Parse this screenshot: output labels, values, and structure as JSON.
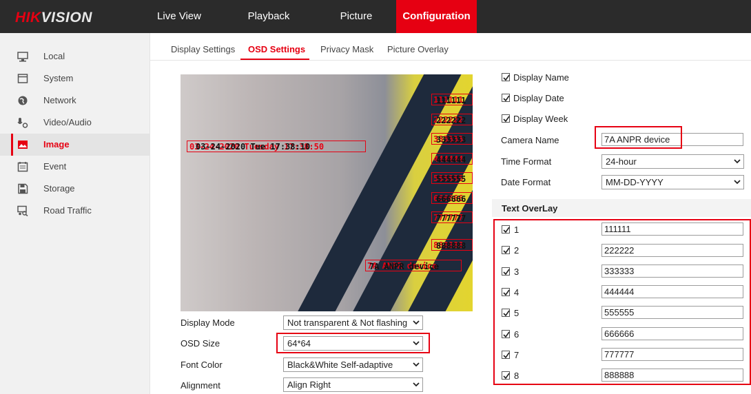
{
  "brand": {
    "part1": "HIK",
    "part2": "VISION"
  },
  "top_nav": [
    {
      "label": "Live View"
    },
    {
      "label": "Playback"
    },
    {
      "label": "Picture"
    },
    {
      "label": "Configuration",
      "active": true
    }
  ],
  "sidebar": [
    {
      "label": "Local"
    },
    {
      "label": "System"
    },
    {
      "label": "Network"
    },
    {
      "label": "Video/Audio"
    },
    {
      "label": "Image",
      "active": true
    },
    {
      "label": "Event"
    },
    {
      "label": "Storage"
    },
    {
      "label": "Road Traffic"
    }
  ],
  "sub_tabs": [
    {
      "label": "Display Settings"
    },
    {
      "label": "OSD Settings",
      "active": true
    },
    {
      "label": "Privacy Mask"
    },
    {
      "label": "Picture Overlay"
    }
  ],
  "osd_preview": {
    "datetime_red": "03-24-2020 Tuesday 17:38:50",
    "datetime_black": "03-24-2020 Tue 17:38:10",
    "camera_name_red": "7A ANPR device",
    "camera_name_black": "7A ANPR device",
    "overlays": [
      "111111",
      "222222",
      "333333",
      "444444",
      "555555",
      "666666",
      "777777",
      "888888"
    ]
  },
  "left_settings": {
    "display_mode": {
      "label": "Display Mode",
      "value": "Not transparent & Not flashing"
    },
    "osd_size": {
      "label": "OSD Size",
      "value": "64*64"
    },
    "font_color": {
      "label": "Font Color",
      "value": "Black&White Self-adaptive"
    },
    "alignment": {
      "label": "Alignment",
      "value": "Align Right"
    }
  },
  "right_settings": {
    "display_name": {
      "label": "Display Name",
      "checked": true
    },
    "display_date": {
      "label": "Display Date",
      "checked": true
    },
    "display_week": {
      "label": "Display Week",
      "checked": true
    },
    "camera_name": {
      "label": "Camera Name",
      "value": "7A ANPR device"
    },
    "time_format": {
      "label": "Time Format",
      "value": "24-hour"
    },
    "date_format": {
      "label": "Date Format",
      "value": "MM-DD-YYYY"
    }
  },
  "text_overlay": {
    "title": "Text OverLay",
    "rows": [
      {
        "num": "1",
        "value": "111111",
        "checked": true
      },
      {
        "num": "2",
        "value": "222222",
        "checked": true
      },
      {
        "num": "3",
        "value": "333333",
        "checked": true
      },
      {
        "num": "4",
        "value": "444444",
        "checked": true
      },
      {
        "num": "5",
        "value": "555555",
        "checked": true
      },
      {
        "num": "6",
        "value": "666666",
        "checked": true
      },
      {
        "num": "7",
        "value": "777777",
        "checked": true
      },
      {
        "num": "8",
        "value": "888888",
        "checked": true
      }
    ]
  },
  "colors": {
    "accent": "#e60012",
    "topbar": "#2b2b2b",
    "sidebar": "#f1f1f1"
  }
}
